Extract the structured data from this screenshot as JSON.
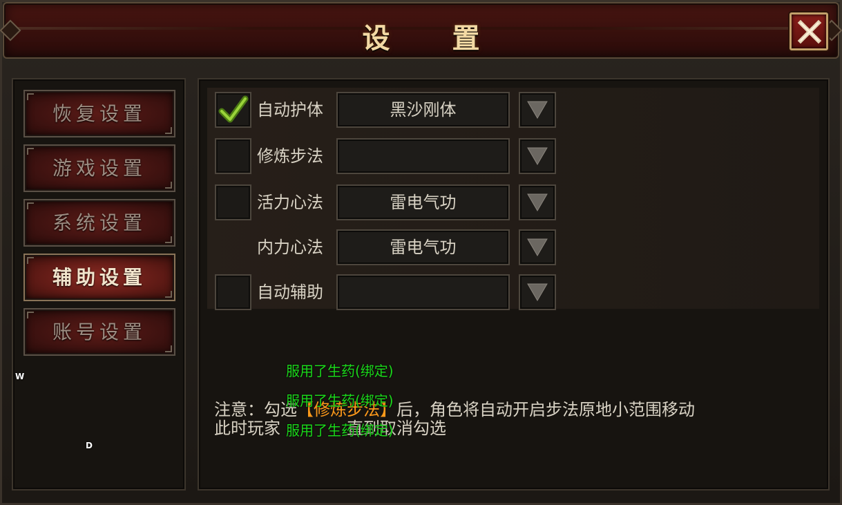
{
  "window": {
    "title": "设 置"
  },
  "sidebar": {
    "items": [
      {
        "label": "恢复设置",
        "active": false
      },
      {
        "label": "游戏设置",
        "active": false
      },
      {
        "label": "系统设置",
        "active": false
      },
      {
        "label": "辅助设置",
        "active": true
      },
      {
        "label": "账号设置",
        "active": false
      }
    ]
  },
  "key_hints": {
    "w": "W",
    "d": "D"
  },
  "settings": {
    "rows": [
      {
        "label": "自动护体",
        "checked": true,
        "has_checkbox": true,
        "value": "黑沙刚体"
      },
      {
        "label": "修炼步法",
        "checked": false,
        "has_checkbox": true,
        "value": ""
      },
      {
        "label": "活力心法",
        "checked": false,
        "has_checkbox": true,
        "value": "雷电气功"
      },
      {
        "label": "内力心法",
        "checked": false,
        "has_checkbox": false,
        "value": "雷电气功"
      },
      {
        "label": "自动辅助",
        "checked": false,
        "has_checkbox": true,
        "value": ""
      }
    ]
  },
  "notice": {
    "line1_prefix": "注意：勾选",
    "line1_highlight": "【修炼步法】",
    "line1_suffix": "后，角色将自动开启步法原地小范围移动",
    "line2_prefix": "此时玩家",
    "line2_suffix": "直到取消勾选"
  },
  "floating_messages": [
    "服用了生药(绑定)",
    "服用了生药(绑定)",
    "服用了生药(绑定)"
  ],
  "colors": {
    "accent_title": "#f3d9a4",
    "highlight": "#ff9a1a",
    "message_green": "#1bd81b",
    "active_tab": "#8a2a22"
  },
  "icons": {
    "close": "close-icon",
    "check": "checkmark-icon",
    "dropdown": "triangle-down-icon"
  }
}
